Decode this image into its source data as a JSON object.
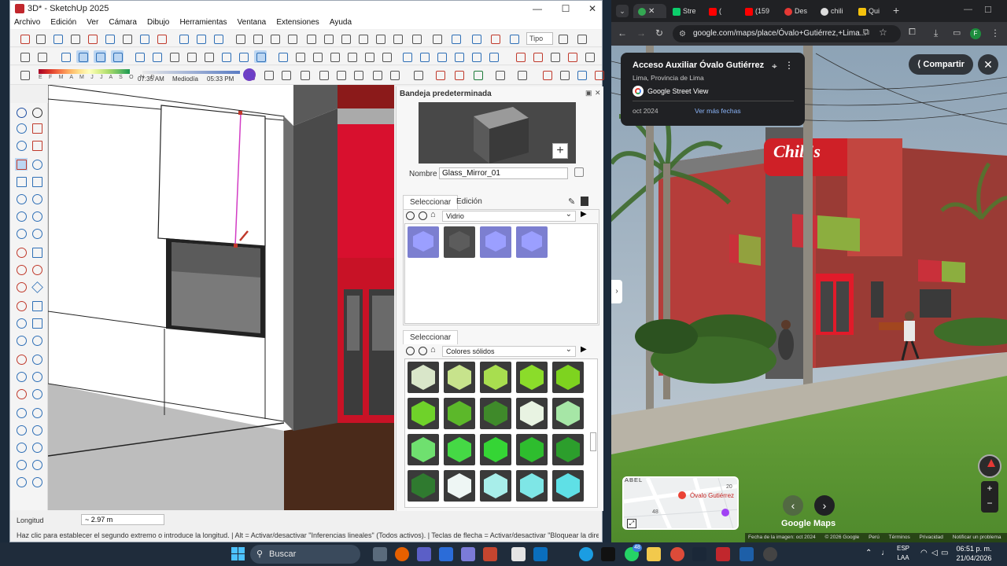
{
  "sketchup": {
    "title": "3D* - SketchUp 2025",
    "menu": [
      "Archivo",
      "Edición",
      "Ver",
      "Cámara",
      "Dibujo",
      "Herramientas",
      "Ventana",
      "Extensiones",
      "Ayuda"
    ],
    "type_field": "Tipo",
    "shadow_months": "E F M A M J J A S O N D",
    "time_start": "07:35 AM",
    "time_mid": "Mediodía",
    "time_end": "05:33 PM",
    "tray": {
      "title": "Bandeja predeterminada",
      "name_label": "Nombre",
      "name_value": "Glass_Mirror_01",
      "tab_select": "Seleccionar",
      "tab_edit": "Edición",
      "library_top": "Vidrio",
      "section2_tab": "Seleccionar",
      "library_bottom": "Colores sólidos",
      "glass_swatches": [
        "#7c7fd0",
        "#4a4a4a",
        "#7c7fd0",
        "#7c7fd0"
      ],
      "solid_swatches": [
        "#d9e6c9",
        "#c7e38c",
        "#a8de4f",
        "#8bdc2a",
        "#7ed31f",
        "#6fd22a",
        "#5cb82a",
        "#3f8a2a",
        "#e8f3e2",
        "#a6e6a6",
        "#6fe06f",
        "#45d945",
        "#35d535",
        "#2ebd2e",
        "#2c9e2c",
        "#2f7a2f",
        "#eef6f4",
        "#a8eeea",
        "#7ee6e6",
        "#5fe0e6"
      ]
    },
    "length_label": "Longitud",
    "length_value": "~ 2.97 m",
    "status_text": "Haz clic para establecer el segundo extremo o introduce la longitud. | Alt = Activar/desactivar \"Inferencias lineales\" (Todos activos). | Teclas de flecha = Activar/desactivar \"Bloquear la direcció"
  },
  "chrome": {
    "tabs": [
      {
        "label": "",
        "active": true
      },
      {
        "label": "Stre",
        "active": false
      },
      {
        "label": "(",
        "active": false
      },
      {
        "label": "(159",
        "active": false
      },
      {
        "label": "Des",
        "active": false
      },
      {
        "label": "chili",
        "active": false
      },
      {
        "label": "Qui",
        "active": false
      }
    ],
    "url": "google.com/maps/place/Óvalo+Gutiérrez,+Lima...",
    "profile_initial": "F",
    "place_title": "Acceso Auxiliar Óvalo Gutiérrez",
    "place_subtitle": "Lima, Provincia de Lima",
    "source": "Google Street View",
    "date": "oct 2024",
    "more_dates": "Ver más fechas",
    "share": "Compartir",
    "minimap_label": "Óvalo Gutiérrez",
    "minimap_street": "ABEL",
    "minimap_num1": "48",
    "minimap_num2": "20",
    "brand": "Google Maps",
    "sign_text": "Chili's",
    "footer": [
      "Fecha de la imagen: oct 2024",
      "© 2026 Google",
      "Perú",
      "Términos",
      "Privacidad",
      "Notificar un problema"
    ]
  },
  "taskbar": {
    "search": "Buscar",
    "lang1": "ESP",
    "lang2": "LAA",
    "time": "06:51 p. m.",
    "date": "21/04/2026",
    "notif_badge": "48"
  }
}
